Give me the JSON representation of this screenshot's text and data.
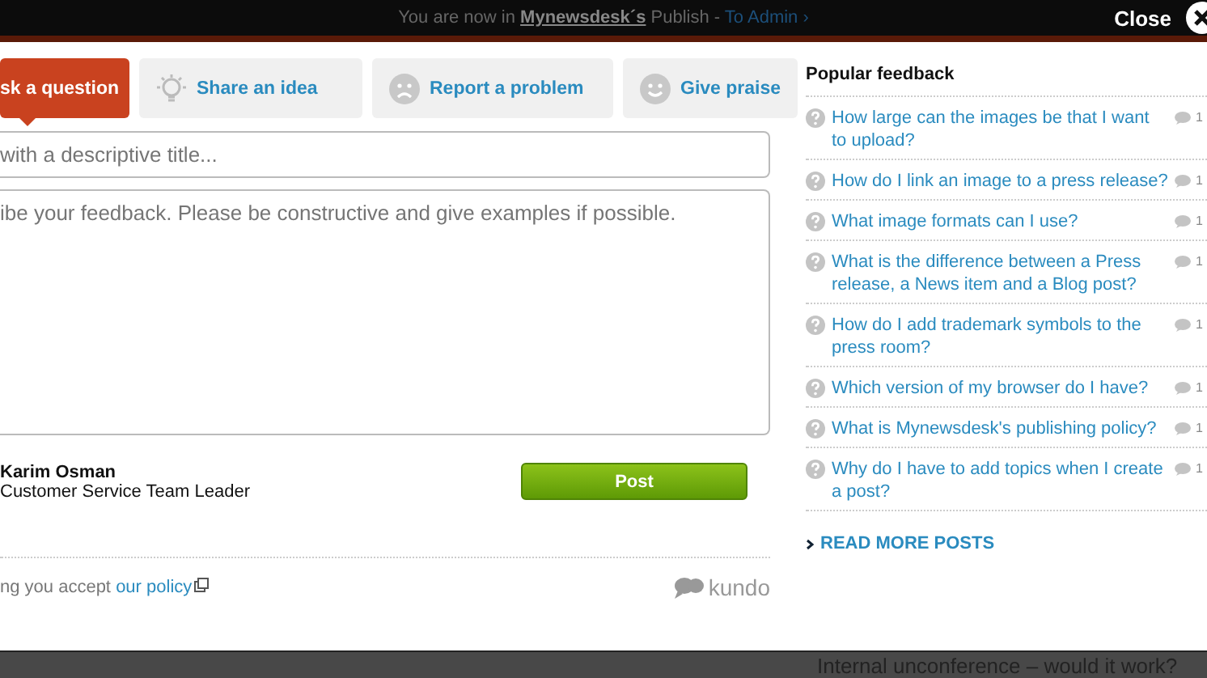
{
  "top_bar": {
    "text": "You are now in **Mynewsdesk´s** Publish - ",
    "admin_link": "To Admin ›",
    "close": "Close"
  },
  "tabs": [
    {
      "label": "sk a question",
      "selected": true
    },
    {
      "label": "Share an idea",
      "selected": false
    },
    {
      "label": "Report a problem",
      "selected": false
    },
    {
      "label": "Give praise",
      "selected": false
    }
  ],
  "title_field": {
    "placeholder": "with a descriptive title..."
  },
  "body_field": {
    "placeholder": "ibe your feedback. Please be constructive and give examples if possible."
  },
  "author": {
    "name": "Karim Osman",
    "role": "Customer Service Team Leader"
  },
  "post_button": "Post",
  "policy": {
    "text": "ng you accept ",
    "link": "our policy"
  },
  "brand": "kundo",
  "popular": {
    "title": "Popular feedback",
    "items": [
      {
        "text": "How large can the images be that I want to upload?",
        "count": "1"
      },
      {
        "text": "How do I link an image to a press release?",
        "count": "1"
      },
      {
        "text": "What image formats can I use?",
        "count": "1"
      },
      {
        "text": "What is the difference between a Press release, a News item and a Blog post?",
        "count": "1"
      },
      {
        "text": "How do I add trademark symbols to the press room?",
        "count": "1"
      },
      {
        "text": "Which version of my browser do I have?",
        "count": "1"
      },
      {
        "text": "What is Mynewsdesk's publishing policy?",
        "count": "1"
      },
      {
        "text": "Why do I have to add topics when I create a post?",
        "count": "1"
      }
    ],
    "more": "READ MORE POSTS"
  },
  "background_post": "Internal unconference – would it work?"
}
